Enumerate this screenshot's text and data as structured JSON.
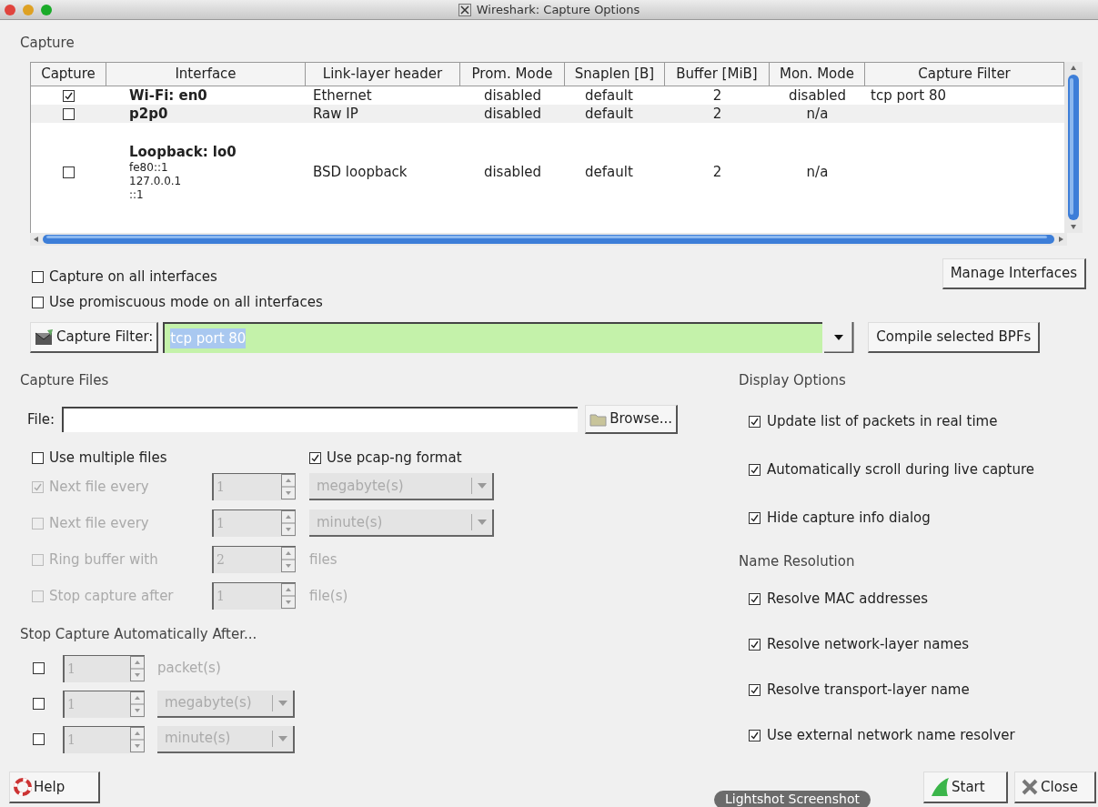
{
  "window": {
    "title": "Wireshark: Capture Options"
  },
  "capture_section": {
    "title": "Capture"
  },
  "interfaces_table": {
    "columns": [
      "Capture",
      "Interface",
      "Link-layer header",
      "Prom. Mode",
      "Snaplen [B]",
      "Buffer [MiB]",
      "Mon. Mode",
      "Capture Filter"
    ],
    "rows": [
      {
        "capture": true,
        "interface": "Wi-Fi: en0",
        "link_layer": "Ethernet",
        "prom_mode": "disabled",
        "snaplen": "default",
        "buffer": "2",
        "mon_mode": "disabled",
        "capture_filter": "tcp port 80"
      },
      {
        "capture": false,
        "interface": "p2p0",
        "link_layer": "Raw IP",
        "prom_mode": "disabled",
        "snaplen": "default",
        "buffer": "2",
        "mon_mode": "n/a"
      },
      {
        "capture": false,
        "interface": "Loopback: lo0",
        "addresses": [
          "fe80::1",
          "127.0.0.1",
          "::1"
        ],
        "link_layer": "BSD loopback",
        "prom_mode": "disabled",
        "snaplen": "default",
        "buffer": "2",
        "mon_mode": "n/a"
      }
    ]
  },
  "global_options": [
    {
      "label": "Capture on all interfaces",
      "checked": false
    },
    {
      "label": "Use promiscuous mode on all interfaces",
      "checked": false
    }
  ],
  "manage_interfaces_button": "Manage Interfaces",
  "capture_filter": {
    "button": "Capture Filter:",
    "value": "tcp port 80",
    "valid": true
  },
  "compile_button": "Compile selected BPFs",
  "capture_files": {
    "title": "Capture Files",
    "file_label": "File:",
    "browse_button": "Browse...",
    "use_multiple_files": {
      "label": "Use multiple files",
      "checked": false
    },
    "pcapng": {
      "label": "Use pcap-ng format",
      "checked": true
    },
    "rows": [
      {
        "label": "Next file every",
        "checked": true,
        "disabled": true,
        "value": "1",
        "unit": "megabyte(s)",
        "kind": "dropdown"
      },
      {
        "label": "Next file every",
        "checked": false,
        "disabled": true,
        "value": "1",
        "unit": "minute(s)",
        "kind": "dropdown"
      },
      {
        "label": "Ring buffer with",
        "checked": false,
        "disabled": true,
        "value": "2",
        "unit": "files",
        "kind": "text"
      },
      {
        "label": "Stop capture after",
        "checked": false,
        "disabled": true,
        "value": "1",
        "unit": "file(s)",
        "kind": "text"
      }
    ]
  },
  "stop_capture": {
    "title": "Stop Capture Automatically After...",
    "rows": [
      {
        "checked": false,
        "disabled": true,
        "value": "1",
        "unit": "packet(s)",
        "kind": "text"
      },
      {
        "checked": false,
        "disabled": true,
        "value": "1",
        "unit": "megabyte(s)",
        "kind": "dropdown"
      },
      {
        "checked": false,
        "disabled": true,
        "value": "1",
        "unit": "minute(s)",
        "kind": "dropdown"
      }
    ]
  },
  "display_options": {
    "title": "Display Options",
    "items": [
      {
        "label": "Update list of packets in real time",
        "checked": true
      },
      {
        "label": "Automatically scroll during live capture",
        "checked": true
      },
      {
        "label": "Hide capture info dialog",
        "checked": true
      }
    ]
  },
  "name_resolution": {
    "title": "Name Resolution",
    "items": [
      {
        "label": "Resolve MAC addresses",
        "checked": true
      },
      {
        "label": "Resolve network-layer names",
        "checked": true
      },
      {
        "label": "Resolve transport-layer name",
        "checked": true
      },
      {
        "label": "Use external network name resolver",
        "checked": true
      }
    ]
  },
  "buttons": {
    "help": "Help",
    "start": "Start",
    "close": "Close"
  },
  "tooltip": "Lightshot Screenshot"
}
